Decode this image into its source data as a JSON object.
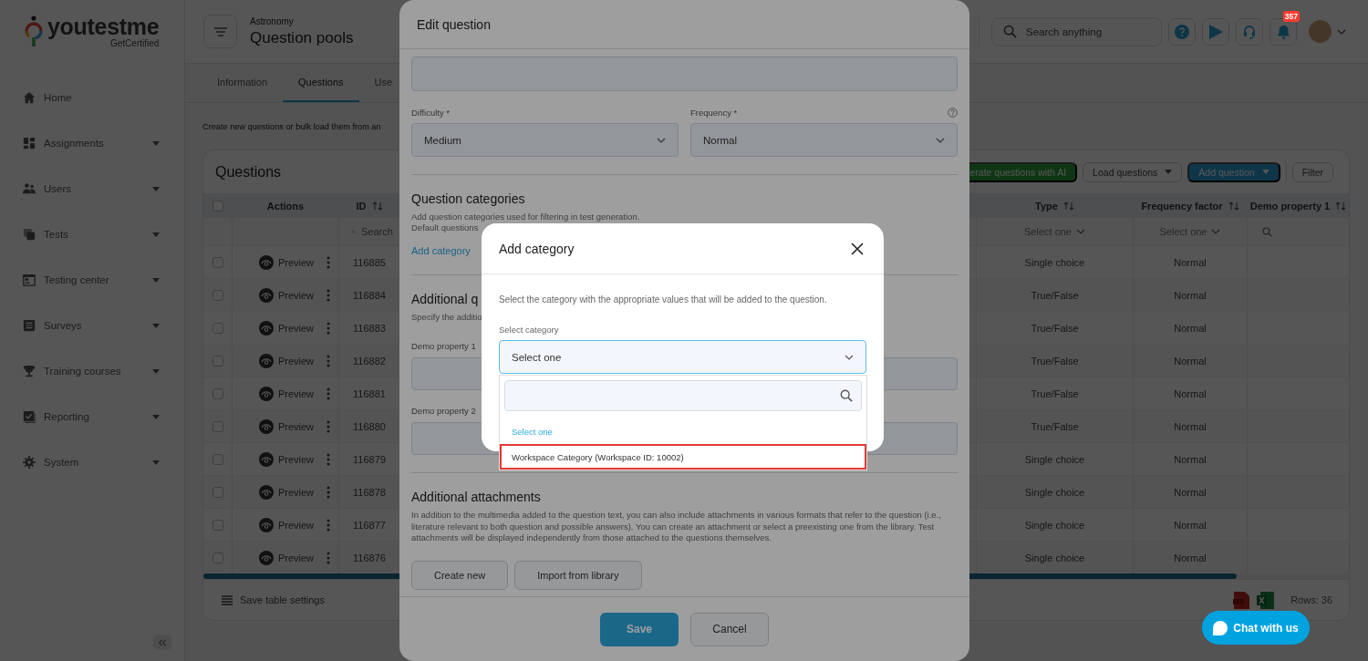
{
  "sidebar": {
    "logo": {
      "name": "youtestme",
      "tagline": "GetCertified"
    },
    "items": [
      {
        "label": "Home",
        "has_submenu": false
      },
      {
        "label": "Assignments",
        "has_submenu": true
      },
      {
        "label": "Users",
        "has_submenu": true
      },
      {
        "label": "Tests",
        "has_submenu": true
      },
      {
        "label": "Testing center",
        "has_submenu": true
      },
      {
        "label": "Surveys",
        "has_submenu": true
      },
      {
        "label": "Training courses",
        "has_submenu": true
      },
      {
        "label": "Reporting",
        "has_submenu": true
      },
      {
        "label": "System",
        "has_submenu": true
      }
    ]
  },
  "header": {
    "breadcrumb": "Astronomy",
    "title": "Question pools",
    "search": {
      "placeholder": "Search anything"
    },
    "notification_count": "357"
  },
  "tabs": [
    {
      "label": "Information",
      "selected": false
    },
    {
      "label": "Questions",
      "selected": true
    },
    {
      "label": "Use",
      "selected": false
    }
  ],
  "intro_text": "Create new questions or bulk load them from an",
  "questions_card": {
    "title": "Questions",
    "toolbar": [
      {
        "label": "erate questions with AI",
        "kind": "ai"
      },
      {
        "label": "Load questions",
        "kind": "dropdown"
      },
      {
        "label": "Add question",
        "kind": "primary-dropdown"
      },
      {
        "label": "Filter",
        "kind": "plain"
      }
    ],
    "table": {
      "select_all_checked": false,
      "columns": [
        {
          "label": "Actions",
          "sortable": false
        },
        {
          "label": "ID",
          "sortable": true
        },
        {
          "label": "Type",
          "sortable": true
        },
        {
          "label": "Frequency factor",
          "sortable": true
        },
        {
          "label": "Demo property 1",
          "sortable": true
        }
      ],
      "filters": {
        "id": {
          "placeholder": "Search"
        },
        "type": "Select one",
        "frequency": "Select one"
      },
      "rows": [
        {
          "checked": false,
          "action": "Preview",
          "id": "116885",
          "type": "Single choice",
          "frequency": "Normal"
        },
        {
          "checked": false,
          "action": "Preview",
          "id": "116884",
          "type": "True/False",
          "frequency": "Normal"
        },
        {
          "checked": false,
          "action": "Preview",
          "id": "116883",
          "type": "True/False",
          "frequency": "Normal"
        },
        {
          "checked": false,
          "action": "Preview",
          "id": "116882",
          "type": "True/False",
          "frequency": "Normal"
        },
        {
          "checked": false,
          "action": "Preview",
          "id": "116881",
          "type": "True/False",
          "frequency": "Normal"
        },
        {
          "checked": false,
          "action": "Preview",
          "id": "116880",
          "type": "True/False",
          "frequency": "Normal"
        },
        {
          "checked": false,
          "action": "Preview",
          "id": "116879",
          "type": "Single choice",
          "frequency": "Normal"
        },
        {
          "checked": false,
          "action": "Preview",
          "id": "116878",
          "type": "Single choice",
          "frequency": "Normal"
        },
        {
          "checked": false,
          "action": "Preview",
          "id": "116877",
          "type": "Single choice",
          "frequency": "Normal"
        },
        {
          "checked": false,
          "action": "Preview",
          "id": "116876",
          "type": "Single choice",
          "frequency": "Normal"
        }
      ]
    },
    "footer": {
      "save_settings": "Save table settings",
      "rows_count": "Rows: 36"
    }
  },
  "edit_question_dialog": {
    "title": "Edit question",
    "fields": [
      {
        "label": "Difficulty *",
        "value": "Medium",
        "help": false
      },
      {
        "label": "Frequency *",
        "value": "Normal",
        "help": true
      }
    ],
    "categories_section": {
      "heading": "Question categories",
      "description_lines": [
        "Add question categories used for filtering in test generation.",
        "Default questions"
      ],
      "link": "Add category"
    },
    "properties_section": {
      "heading": "Additional q",
      "description": "Specify the additio",
      "fields": [
        {
          "label": "Demo property 1"
        },
        {
          "label": "Demo property 2"
        }
      ]
    },
    "attachments_section": {
      "heading": "Additional attachments",
      "description": "In addition to the multimedia added to the question text, you can also include attachments in various formats that refer to the question (i.e., literature relevant to both question and possible answers). You can create an attachment or select a preexisting one from the library. Test attachments will be displayed independently from those attached to the questions themselves.",
      "buttons": [
        "Create new",
        "Import from library"
      ]
    },
    "footer_buttons": [
      {
        "label": "Save",
        "kind": "primary"
      },
      {
        "label": "Cancel",
        "kind": "secondary"
      }
    ]
  },
  "add_category_dialog": {
    "title": "Add category",
    "description": "Select the category with the appropriate values that will be added to the question.",
    "select": {
      "label": "Select category",
      "value": "Select one",
      "expanded": true
    },
    "options": [
      {
        "label": "Select one",
        "selected": true,
        "highlighted": false
      },
      {
        "label": "Workspace Category (Workspace ID: 10002)",
        "selected": false,
        "highlighted": true
      }
    ]
  },
  "chat_button": {
    "label": "Chat with us"
  }
}
